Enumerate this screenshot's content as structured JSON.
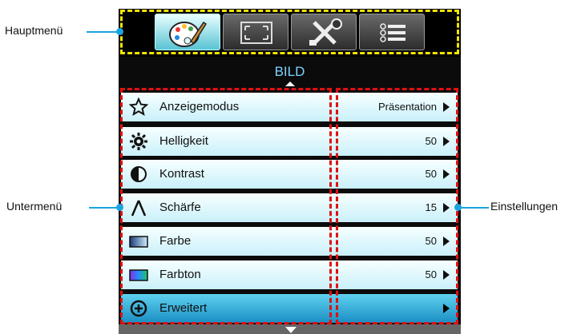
{
  "main_menu": {
    "tabs": [
      {
        "icon": "palette-icon",
        "active": true
      },
      {
        "icon": "screen-corners-icon",
        "active": false
      },
      {
        "icon": "tools-icon",
        "active": false
      },
      {
        "icon": "list-icon",
        "active": false
      }
    ]
  },
  "title": "BILD",
  "menu_items": [
    {
      "label": "Anzeigemodus",
      "value": "Präsentation",
      "icon": "star-icon"
    },
    {
      "label": "Helligkeit",
      "value": "50",
      "icon": "gear-brightness-icon"
    },
    {
      "label": "Kontrast",
      "value": "50",
      "icon": "contrast-icon"
    },
    {
      "label": "Schärfe",
      "value": "15",
      "icon": "sharpness-icon"
    },
    {
      "label": "Farbe",
      "value": "50",
      "icon": "color-gradient-icon"
    },
    {
      "label": "Farbton",
      "value": "50",
      "icon": "tint-gradient-icon"
    },
    {
      "label": "Erweitert",
      "value": "",
      "icon": "plus-circle-icon",
      "selected": true
    }
  ],
  "callouts": {
    "main_menu": "Hauptmenü",
    "submenu": "Untermenü",
    "settings": "Einstellungen"
  },
  "colors": {
    "highlight_yellow": "#f5e400",
    "highlight_red": "#e01010",
    "callout_blue": "#1aa3e0",
    "title_text": "#7fd3ff"
  }
}
